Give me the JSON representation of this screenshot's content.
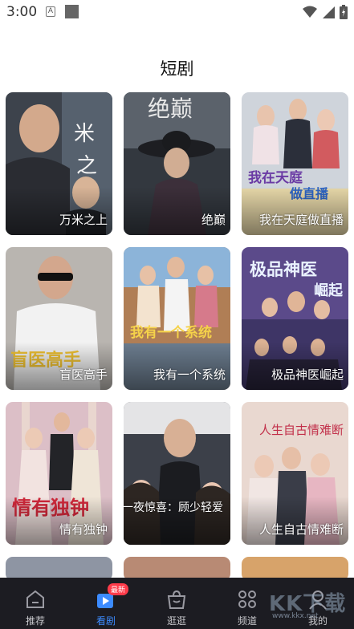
{
  "status": {
    "time": "3:00",
    "a_icon_label": "A"
  },
  "page": {
    "title": "短剧"
  },
  "dramas": [
    {
      "title": "万米之上",
      "bg": "#3a3f48"
    },
    {
      "title": "绝巅",
      "bg": "#2f3540"
    },
    {
      "title": "我在天庭做直播",
      "bg": "#c9cfd8"
    },
    {
      "title": "盲医高手",
      "bg": "#b9b4ae"
    },
    {
      "title": "我有一个系统",
      "bg": "#a57f5d"
    },
    {
      "title": "极品神医崛起",
      "bg": "#5e4a8c"
    },
    {
      "title": "情有独钟",
      "bg": "#d9b8c2"
    },
    {
      "title": "一夜惊喜：顾少轻爱",
      "bg": "#3b3f47"
    },
    {
      "title": "人生自古情难断",
      "bg": "#e7d6cf"
    }
  ],
  "tabs": [
    {
      "label": "推荐",
      "icon": "home-icon"
    },
    {
      "label": "看剧",
      "icon": "play-icon",
      "badge": "最新"
    },
    {
      "label": "逛逛",
      "icon": "bag-icon"
    },
    {
      "label": "频道",
      "icon": "grid-icon"
    },
    {
      "label": "我的",
      "icon": "person-icon"
    }
  ],
  "watermark": {
    "text": "KK下载",
    "url": "www.kkx.net"
  },
  "colors": {
    "accent": "#3c8bff",
    "tabbar_bg": "#1c1c22",
    "badge": "#ff3b4a"
  }
}
